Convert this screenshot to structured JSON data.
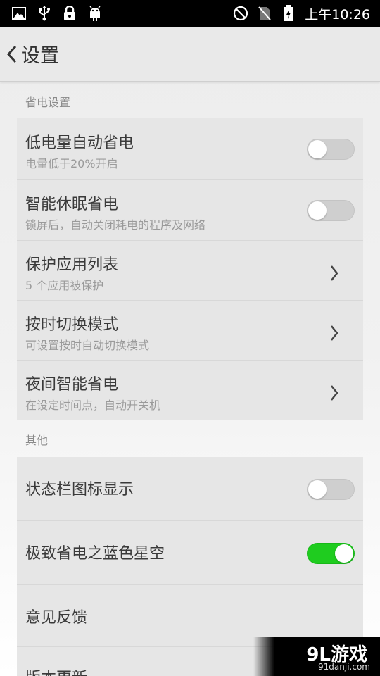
{
  "status_bar": {
    "time": "上午10:26",
    "left_icons": [
      "gallery-icon",
      "usb-icon",
      "lock-icon",
      "android-icon"
    ],
    "right_icons": [
      "do-not-disturb-icon",
      "no-sim-icon",
      "battery-icon"
    ]
  },
  "header": {
    "title": "设置"
  },
  "sections": {
    "power": {
      "title": "省电设置"
    },
    "other": {
      "title": "其他"
    }
  },
  "rows": {
    "low_power": {
      "title": "低电量自动省电",
      "subtitle": "电量低于20%开启",
      "toggle": false
    },
    "smart_sleep": {
      "title": "智能休眠省电",
      "subtitle": "锁屏后，自动关闭耗电的程序及网络",
      "toggle": false
    },
    "protected_apps": {
      "title": "保护应用列表",
      "subtitle": "5 个应用被保护"
    },
    "timed_mode": {
      "title": "按时切换模式",
      "subtitle": "可设置按时自动切换模式"
    },
    "night_saver": {
      "title": "夜间智能省电",
      "subtitle": "在设定时间点，自动开关机"
    },
    "status_icon": {
      "title": "状态栏图标显示",
      "toggle": false
    },
    "blue_star": {
      "title": "极致省电之蓝色星空",
      "toggle": true
    },
    "feedback": {
      "title": "意见反馈"
    },
    "version": {
      "title": "版本更新"
    }
  },
  "watermark": {
    "logo": "9L游戏",
    "url": "91danji.com"
  },
  "colors": {
    "toggle_on": "#1fcc1f",
    "toggle_off": "#cfcfcf",
    "card": "#e6e6e6"
  }
}
